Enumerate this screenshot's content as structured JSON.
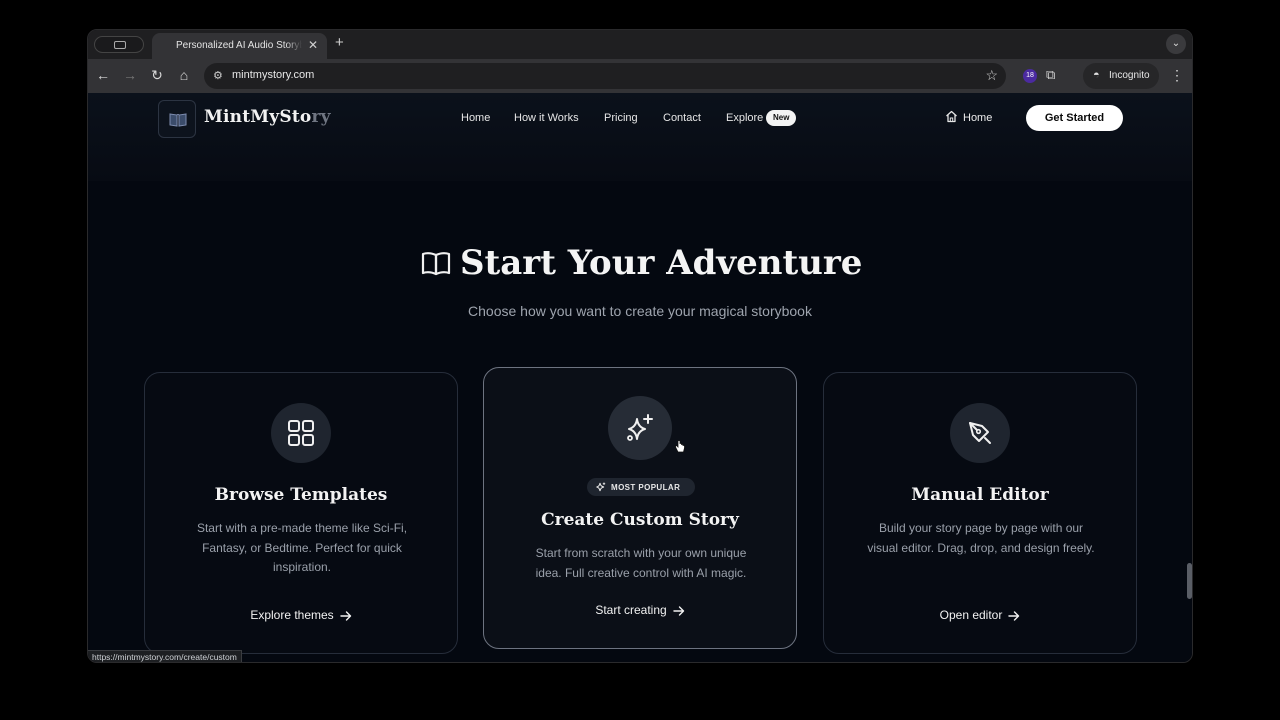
{
  "browser": {
    "tab_title": "Personalized AI Audio Storybook",
    "tab_close": "✕",
    "new_tab": "+",
    "url": "mintmystory.com",
    "extension_badge": "18",
    "incognito_label": "Incognito",
    "status_url": "https://mintmystory.com/create/custom"
  },
  "header": {
    "brand_main": "MintMySto",
    "brand_fade": "ry",
    "nav": [
      {
        "label": "Home"
      },
      {
        "label": "How it Works"
      },
      {
        "label": "Pricing"
      },
      {
        "label": "Contact"
      },
      {
        "label": "Explore"
      }
    ],
    "explore_badge": "New",
    "home_link": "Home",
    "cta": "Get Started"
  },
  "hero": {
    "title": "Start Your Adventure",
    "subtitle": "Choose how you want to create your magical storybook"
  },
  "cards": [
    {
      "icon": "grid-icon",
      "title": "Browse Templates",
      "description": "Start with a pre-made theme like Sci-Fi, Fantasy, or Bedtime. Perfect for quick inspiration.",
      "link": "Explore themes"
    },
    {
      "icon": "sparkles-icon",
      "badge": "MOST POPULAR",
      "title": "Create Custom Story",
      "description": "Start from scratch with your own unique idea. Full creative control with AI magic.",
      "link": "Start creating"
    },
    {
      "icon": "pen-tool-icon",
      "title": "Manual Editor",
      "description": "Build your story page by page with our visual editor. Drag, drop, and design freely.",
      "link": "Open editor"
    }
  ],
  "colors": {
    "page_bg": "#040810",
    "card_border": "#262d3a",
    "featured_border": "#6d7380",
    "cta_bg": "#ffffff",
    "extension_badge": "#4b2aa0"
  }
}
